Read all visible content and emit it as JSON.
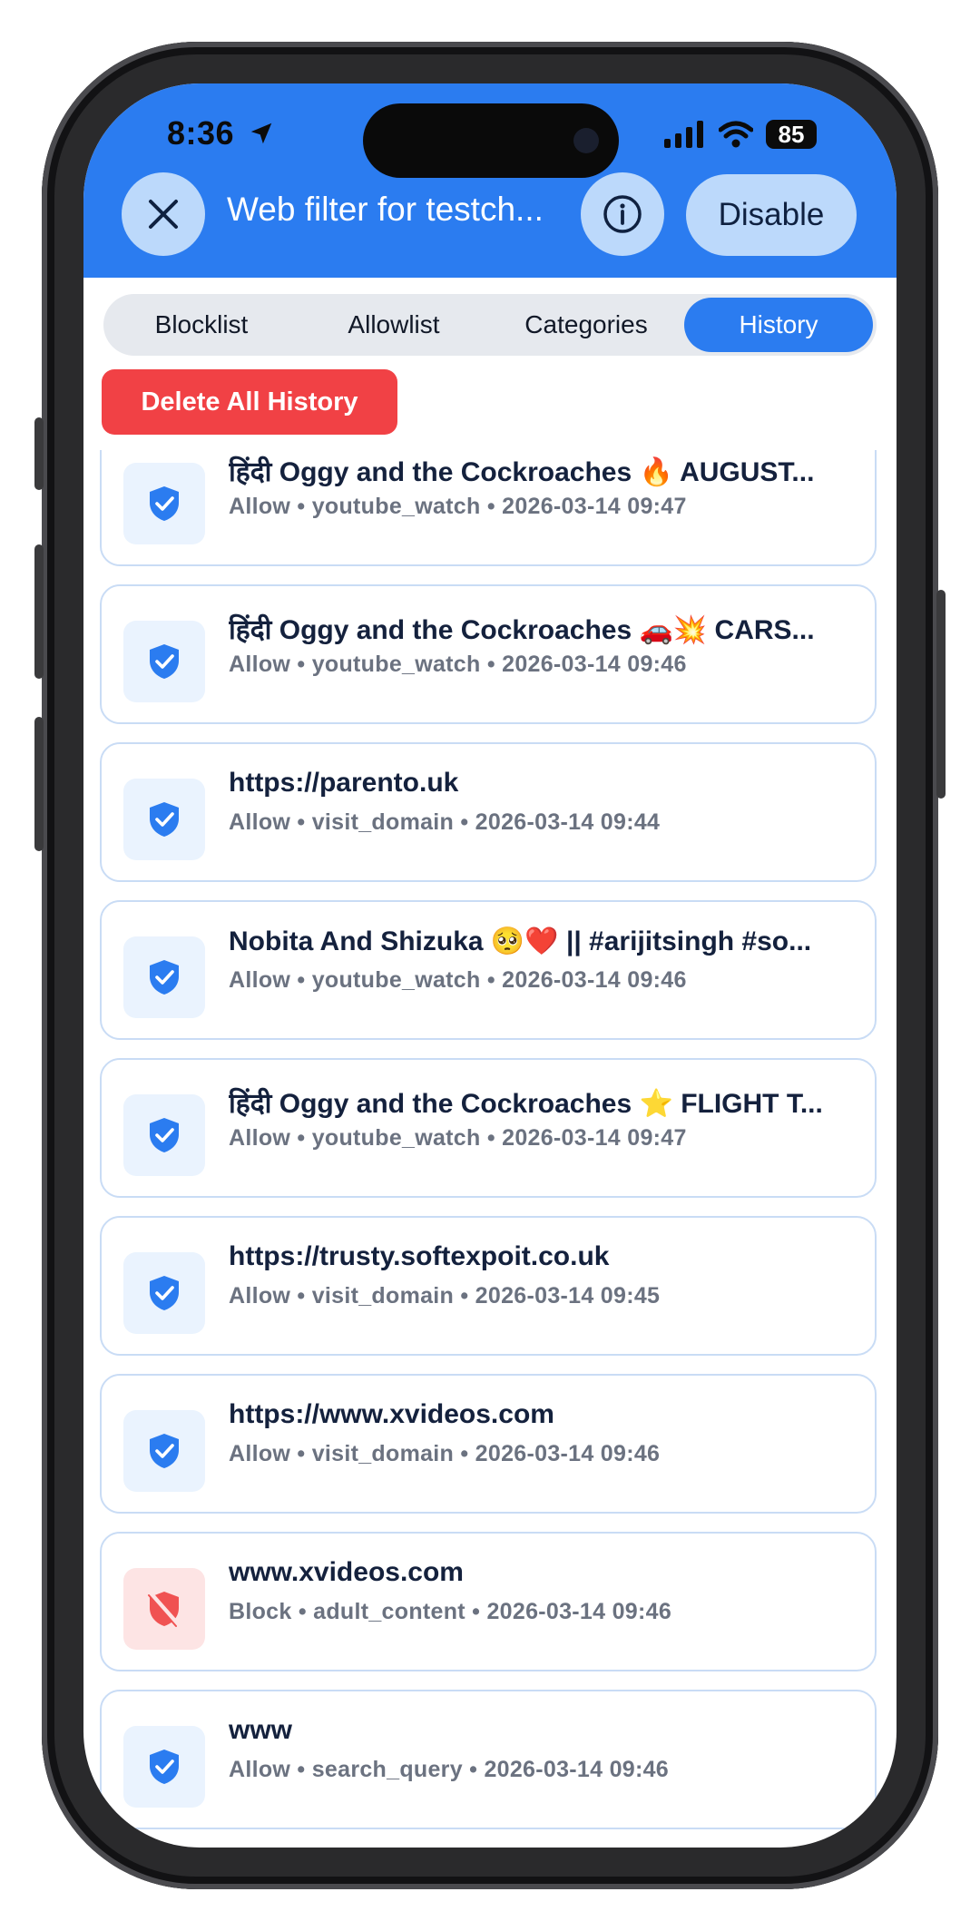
{
  "status_bar": {
    "time": "8:36",
    "battery": "85"
  },
  "header": {
    "title": "Web filter for testch...",
    "disable_label": "Disable"
  },
  "tabs": [
    {
      "label": "Blocklist",
      "active": false
    },
    {
      "label": "Allowlist",
      "active": false
    },
    {
      "label": "Categories",
      "active": false
    },
    {
      "label": "History",
      "active": true
    }
  ],
  "delete_all_label": "Delete All History",
  "colors": {
    "accent": "#2b7cf0",
    "delete": "#f14145",
    "allow_icon": "#2b7cf0",
    "block_icon": "#f05252"
  },
  "history": [
    {
      "title": "हिंदी Oggy and the Cockroaches 🔥 AUGUST...",
      "meta": "Allow • youtube_watch • 2026-03-14 09:47",
      "status": "allow",
      "icon": "shield-check-icon"
    },
    {
      "title": "हिंदी Oggy and the Cockroaches 🚗💥 CARS...",
      "meta": "Allow • youtube_watch • 2026-03-14 09:46",
      "status": "allow",
      "icon": "shield-check-icon"
    },
    {
      "title": "https://parento.uk",
      "meta": "Allow • visit_domain • 2026-03-14 09:44",
      "status": "allow",
      "icon": "shield-check-icon"
    },
    {
      "title": "Nobita And Shizuka 🥺❤️ || #arijitsingh #so...",
      "meta": "Allow • youtube_watch • 2026-03-14 09:46",
      "status": "allow",
      "icon": "shield-check-icon"
    },
    {
      "title": "हिंदी Oggy and the Cockroaches ⭐ FLIGHT T...",
      "meta": "Allow • youtube_watch • 2026-03-14 09:47",
      "status": "allow",
      "icon": "shield-check-icon"
    },
    {
      "title": "https://trusty.softexpoit.co.uk",
      "meta": "Allow • visit_domain • 2026-03-14 09:45",
      "status": "allow",
      "icon": "shield-check-icon"
    },
    {
      "title": "https://www.xvideos.com",
      "meta": "Allow • visit_domain • 2026-03-14 09:46",
      "status": "allow",
      "icon": "shield-check-icon"
    },
    {
      "title": "www.xvideos.com",
      "meta": "Block • adult_content • 2026-03-14 09:46",
      "status": "block",
      "icon": "shield-off-icon"
    },
    {
      "title": "www",
      "meta": "Allow • search_query • 2026-03-14 09:46",
      "status": "allow",
      "icon": "shield-check-icon"
    }
  ]
}
